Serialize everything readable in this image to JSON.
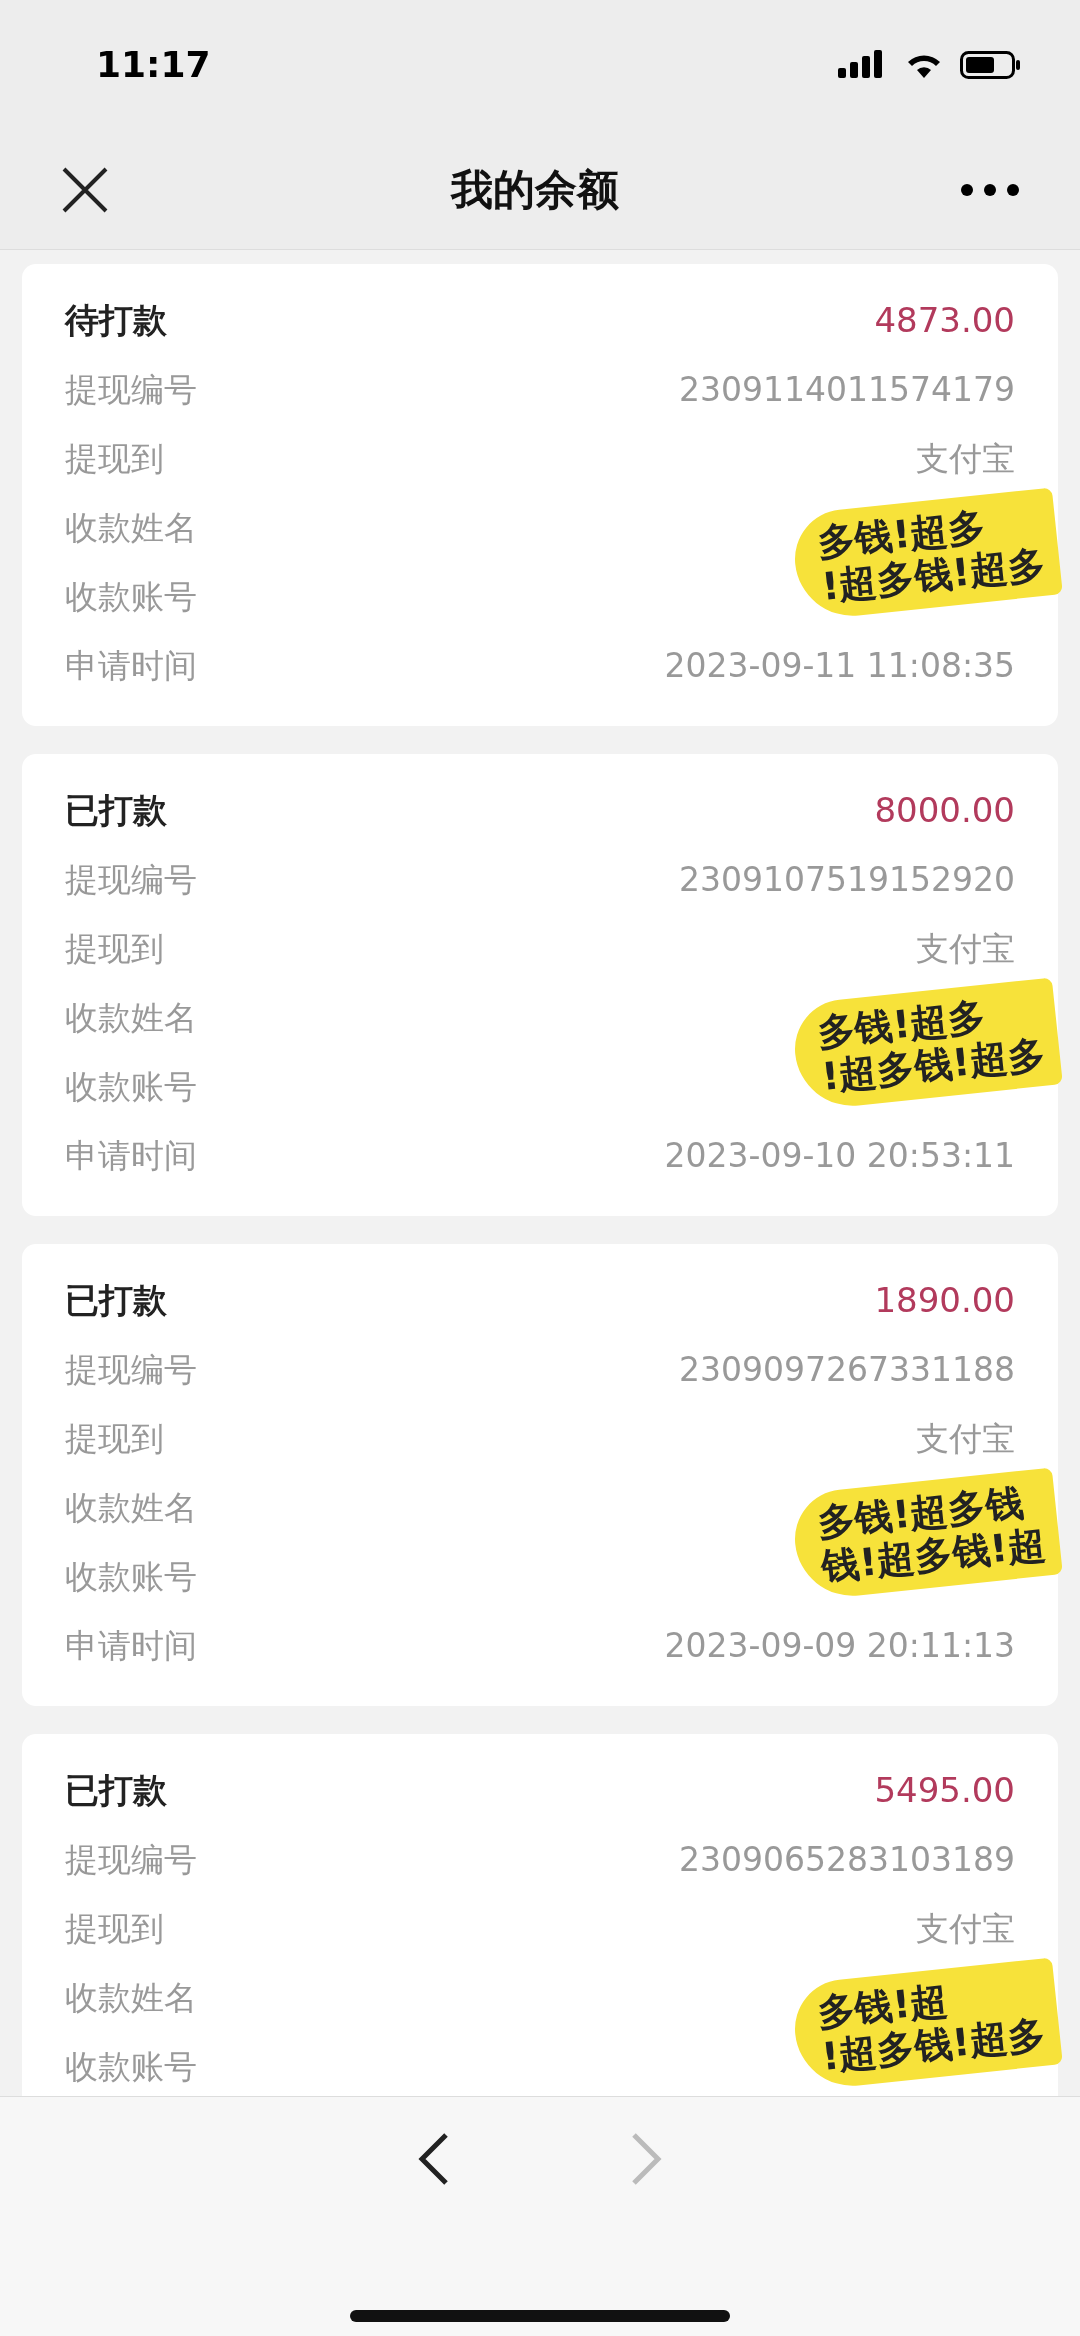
{
  "status_bar": {
    "time": "11:17"
  },
  "nav": {
    "title": "我的余额"
  },
  "records": [
    {
      "status": "待打款",
      "amount": "4873.00",
      "fields": [
        {
          "label": "提现编号",
          "value": "2309114011574179"
        },
        {
          "label": "提现到",
          "value": "支付宝"
        },
        {
          "label": "收款姓名"
        },
        {
          "label": "收款账号"
        },
        {
          "label": "申请时间",
          "value": "2023-09-11 11:08:35"
        }
      ],
      "sticker": [
        "多钱!超多",
        "!超多钱!超多"
      ]
    },
    {
      "status": "已打款",
      "amount": "8000.00",
      "fields": [
        {
          "label": "提现编号",
          "value": "2309107519152920"
        },
        {
          "label": "提现到",
          "value": "支付宝"
        },
        {
          "label": "收款姓名"
        },
        {
          "label": "收款账号"
        },
        {
          "label": "申请时间",
          "value": "2023-09-10 20:53:11"
        }
      ],
      "sticker": [
        "多钱!超多",
        "!超多钱!超多"
      ]
    },
    {
      "status": "已打款",
      "amount": "1890.00",
      "fields": [
        {
          "label": "提现编号",
          "value": "2309097267331188"
        },
        {
          "label": "提现到",
          "value": "支付宝"
        },
        {
          "label": "收款姓名"
        },
        {
          "label": "收款账号"
        },
        {
          "label": "申请时间",
          "value": "2023-09-09 20:11:13"
        }
      ],
      "sticker": [
        "多钱!超多钱",
        "钱!超多钱!超"
      ]
    },
    {
      "status": "已打款",
      "amount": "5495.00",
      "fields": [
        {
          "label": "提现编号",
          "value": "2309065283103189"
        },
        {
          "label": "提现到",
          "value": "支付宝"
        },
        {
          "label": "收款姓名"
        },
        {
          "label": "收款账号"
        }
      ],
      "sticker": [
        "多钱!超",
        "!超多钱!超多"
      ]
    }
  ],
  "toolbar": {
    "back_disabled": false,
    "forward_disabled": true
  }
}
